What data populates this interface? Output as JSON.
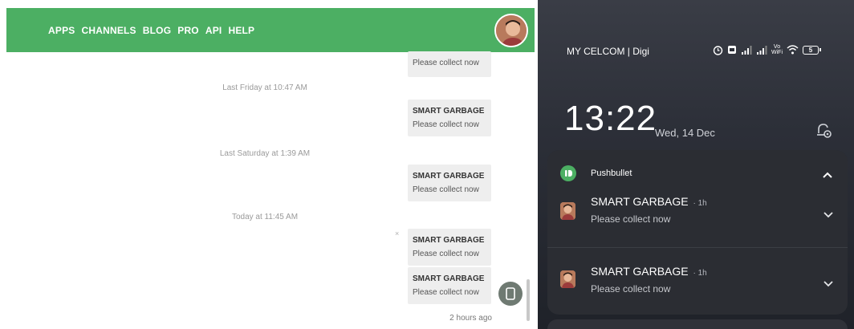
{
  "web": {
    "nav": [
      "APPS",
      "CHANNELS",
      "BLOG",
      "PRO",
      "API",
      "HELP"
    ],
    "partial_message_body": "Please collect now",
    "messages": [
      {
        "timestamp": "Last Friday at 10:47 AM",
        "title": "SMART GARBAGE",
        "body": "Please collect now"
      },
      {
        "timestamp": "Last Saturday at 1:39 AM",
        "title": "SMART GARBAGE",
        "body": "Please collect now"
      },
      {
        "timestamp": "Today at 11:45 AM",
        "title": "SMART GARBAGE",
        "body": "Please collect now"
      },
      {
        "timestamp": "",
        "title": "SMART GARBAGE",
        "body": "Please collect now"
      }
    ],
    "dismiss_glyph": "×",
    "last_sent": "2 hours ago"
  },
  "phone": {
    "carrier": "MY CELCOM | Digi",
    "status_icons": [
      "alarm-icon",
      "nfc-icon",
      "signal-icon",
      "signal-icon",
      "vowifi-icon",
      "wifi-icon",
      "battery-icon"
    ],
    "vowifi_text": "Vo WiFi",
    "battery": "5",
    "clock": "13:22",
    "date": "Wed, 14 Dec",
    "app_name": "Pushbullet",
    "accent": "#4caf63",
    "notifications": [
      {
        "title": "SMART GARBAGE",
        "time": "· 1h",
        "body": "Please collect now"
      },
      {
        "title": "SMART GARBAGE",
        "time": "· 1h",
        "body": "Please collect now"
      }
    ]
  }
}
